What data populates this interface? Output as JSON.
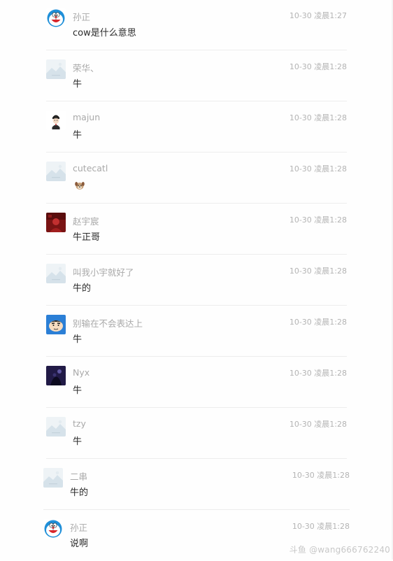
{
  "comments": [
    {
      "username": "孙正",
      "time": "10-30 凌晨1:27",
      "message": "cow是什么意思",
      "avatar": "doraemon-icon"
    },
    {
      "username": "荣华、",
      "time": "10-30 凌晨1:28",
      "message": "牛",
      "avatar": "default-avatar-icon"
    },
    {
      "username": "majun",
      "time": "10-30 凌晨1:28",
      "message": "牛",
      "avatar": "cartoon-person-icon"
    },
    {
      "username": "cutecatl",
      "time": "10-30 凌晨1:28",
      "message": "",
      "avatar": "default-avatar-icon",
      "emoji": "dog-face-emoji"
    },
    {
      "username": "赵宇宸",
      "time": "10-30 凌晨1:28",
      "message": "牛正哥",
      "avatar": "red-photo-avatar"
    },
    {
      "username": "叫我小宇就好了",
      "time": "10-30 凌晨1:28",
      "message": "牛的",
      "avatar": "default-avatar-icon"
    },
    {
      "username": "别输在不会表达上",
      "time": "10-30 凌晨1:28",
      "message": "牛",
      "avatar": "crayon-shinchan-icon"
    },
    {
      "username": "Nyx",
      "time": "10-30 凌晨1:28",
      "message": "牛",
      "avatar": "dark-night-avatar"
    },
    {
      "username": "tzy",
      "time": "10-30 凌晨1:28",
      "message": "牛",
      "avatar": "default-avatar-icon"
    },
    {
      "username": "二串",
      "time": "10-30 凌晨1:28",
      "message": "牛的",
      "avatar": "default-avatar-icon"
    },
    {
      "username": "孙正",
      "time": "10-30 凌晨1:28",
      "message": "说啊",
      "avatar": "doraemon-icon"
    }
  ],
  "watermark": "斗鱼 @wang666762240"
}
